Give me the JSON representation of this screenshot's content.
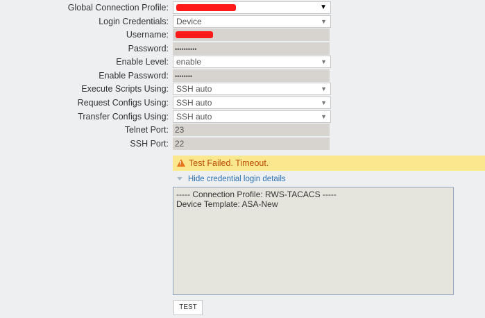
{
  "form": {
    "global_profile": {
      "label": "Global Connection Profile:",
      "value": ""
    },
    "login_credentials": {
      "label": "Login Credentials:",
      "value": "Device"
    },
    "username": {
      "label": "Username:",
      "value": ""
    },
    "password": {
      "label": "Password:",
      "value": "••••••••••"
    },
    "enable_level": {
      "label": "Enable Level:",
      "value": "enable"
    },
    "enable_password": {
      "label": "Enable Password:",
      "value": "••••••••"
    },
    "execute_scripts": {
      "label": "Execute Scripts Using:",
      "value": "SSH auto"
    },
    "request_configs": {
      "label": "Request Configs Using:",
      "value": "SSH auto"
    },
    "transfer_configs": {
      "label": "Transfer Configs Using:",
      "value": "SSH auto"
    },
    "telnet_port": {
      "label": "Telnet Port:",
      "value": "23"
    },
    "ssh_port": {
      "label": "SSH Port:",
      "value": "22"
    }
  },
  "status": {
    "message": "Test Failed. Timeout.",
    "icon": "warning-icon"
  },
  "details_toggle": {
    "label": "Hide credential login details"
  },
  "log": {
    "line1": "----- Connection Profile: RWS-TACACS -----",
    "line2": "Device Template: ASA-New"
  },
  "test_button": {
    "label": "TEST"
  },
  "colors": {
    "warning_bg": "#fbe88e",
    "warning_text": "#b94a00",
    "link": "#2a6fb0"
  }
}
